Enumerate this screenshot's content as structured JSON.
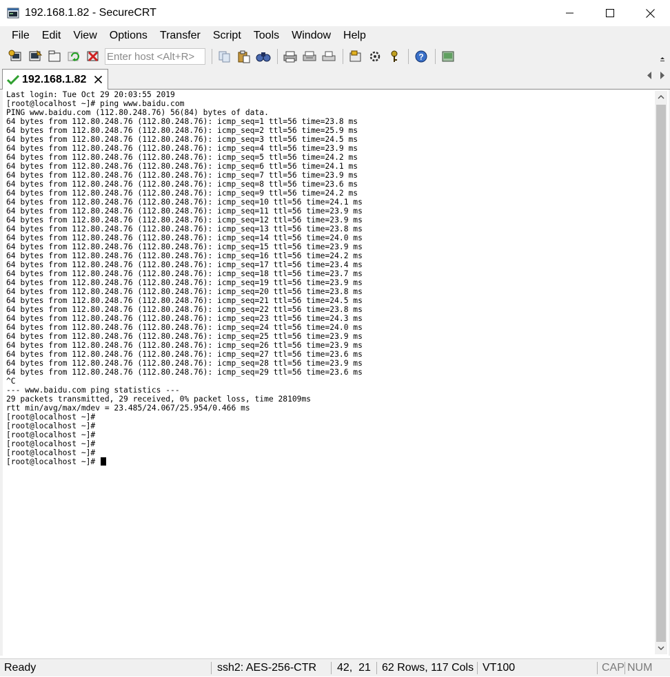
{
  "window": {
    "title": "192.168.1.82 - SecureCRT",
    "minimize": "—",
    "maximize": "☐",
    "close": "✕"
  },
  "menu": [
    "File",
    "Edit",
    "View",
    "Options",
    "Transfer",
    "Script",
    "Tools",
    "Window",
    "Help"
  ],
  "toolbar": {
    "host_placeholder": "Enter host <Alt+R>",
    "icons": [
      "connect-icon",
      "quick-connect-icon",
      "connect-tab-icon",
      "reconnect-icon",
      "disconnect-icon",
      "copy-icon",
      "paste-icon",
      "find-icon",
      "print-icon",
      "print-selection-icon",
      "printer-icon",
      "session-options-icon",
      "global-options-icon",
      "keymap-icon",
      "help-icon",
      "sftp-icon"
    ]
  },
  "tab": {
    "label": "192.168.1.82",
    "close": "✕"
  },
  "terminal": {
    "lines": [
      "Last login: Tue Oct 29 20:03:55 2019",
      "[root@localhost ~]# ping www.baidu.com",
      "PING www.baidu.com (112.80.248.76) 56(84) bytes of data.",
      "64 bytes from 112.80.248.76 (112.80.248.76): icmp_seq=1 ttl=56 time=23.8 ms",
      "64 bytes from 112.80.248.76 (112.80.248.76): icmp_seq=2 ttl=56 time=25.9 ms",
      "64 bytes from 112.80.248.76 (112.80.248.76): icmp_seq=3 ttl=56 time=24.5 ms",
      "64 bytes from 112.80.248.76 (112.80.248.76): icmp_seq=4 ttl=56 time=23.9 ms",
      "64 bytes from 112.80.248.76 (112.80.248.76): icmp_seq=5 ttl=56 time=24.2 ms",
      "64 bytes from 112.80.248.76 (112.80.248.76): icmp_seq=6 ttl=56 time=24.1 ms",
      "64 bytes from 112.80.248.76 (112.80.248.76): icmp_seq=7 ttl=56 time=23.9 ms",
      "64 bytes from 112.80.248.76 (112.80.248.76): icmp_seq=8 ttl=56 time=23.6 ms",
      "64 bytes from 112.80.248.76 (112.80.248.76): icmp_seq=9 ttl=56 time=24.2 ms",
      "64 bytes from 112.80.248.76 (112.80.248.76): icmp_seq=10 ttl=56 time=24.1 ms",
      "64 bytes from 112.80.248.76 (112.80.248.76): icmp_seq=11 ttl=56 time=23.9 ms",
      "64 bytes from 112.80.248.76 (112.80.248.76): icmp_seq=12 ttl=56 time=23.9 ms",
      "64 bytes from 112.80.248.76 (112.80.248.76): icmp_seq=13 ttl=56 time=23.8 ms",
      "64 bytes from 112.80.248.76 (112.80.248.76): icmp_seq=14 ttl=56 time=24.0 ms",
      "64 bytes from 112.80.248.76 (112.80.248.76): icmp_seq=15 ttl=56 time=23.9 ms",
      "64 bytes from 112.80.248.76 (112.80.248.76): icmp_seq=16 ttl=56 time=24.2 ms",
      "64 bytes from 112.80.248.76 (112.80.248.76): icmp_seq=17 ttl=56 time=23.4 ms",
      "64 bytes from 112.80.248.76 (112.80.248.76): icmp_seq=18 ttl=56 time=23.7 ms",
      "64 bytes from 112.80.248.76 (112.80.248.76): icmp_seq=19 ttl=56 time=23.9 ms",
      "64 bytes from 112.80.248.76 (112.80.248.76): icmp_seq=20 ttl=56 time=23.8 ms",
      "64 bytes from 112.80.248.76 (112.80.248.76): icmp_seq=21 ttl=56 time=24.5 ms",
      "64 bytes from 112.80.248.76 (112.80.248.76): icmp_seq=22 ttl=56 time=23.8 ms",
      "64 bytes from 112.80.248.76 (112.80.248.76): icmp_seq=23 ttl=56 time=24.3 ms",
      "64 bytes from 112.80.248.76 (112.80.248.76): icmp_seq=24 ttl=56 time=24.0 ms",
      "64 bytes from 112.80.248.76 (112.80.248.76): icmp_seq=25 ttl=56 time=23.9 ms",
      "64 bytes from 112.80.248.76 (112.80.248.76): icmp_seq=26 ttl=56 time=23.9 ms",
      "64 bytes from 112.80.248.76 (112.80.248.76): icmp_seq=27 ttl=56 time=23.6 ms",
      "64 bytes from 112.80.248.76 (112.80.248.76): icmp_seq=28 ttl=56 time=23.9 ms",
      "64 bytes from 112.80.248.76 (112.80.248.76): icmp_seq=29 ttl=56 time=23.6 ms",
      "^C",
      "--- www.baidu.com ping statistics ---",
      "29 packets transmitted, 29 received, 0% packet loss, time 28109ms",
      "rtt min/avg/max/mdev = 23.485/24.067/25.954/0.466 ms",
      "[root@localhost ~]#",
      "[root@localhost ~]#",
      "[root@localhost ~]#",
      "[root@localhost ~]#",
      "[root@localhost ~]#",
      "[root@localhost ~]# "
    ]
  },
  "status": {
    "state": "Ready",
    "protocol": "ssh2: AES-256-CTR",
    "cursor_pos": "42,  21",
    "dimensions": "62 Rows, 117 Cols",
    "terminal_type": "VT100",
    "cap": "CAP",
    "num": "NUM"
  }
}
